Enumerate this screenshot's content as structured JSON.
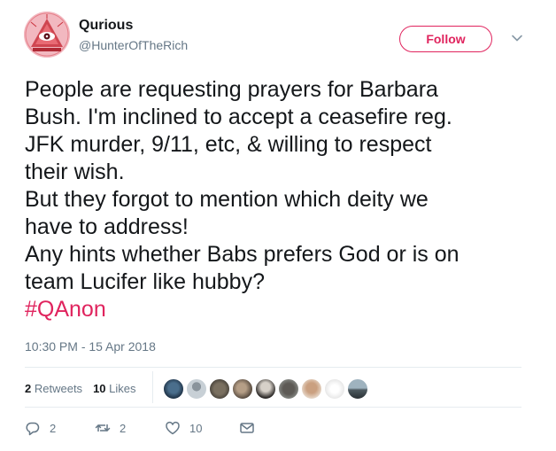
{
  "user": {
    "display_name": "Qurious",
    "handle": "@HunterOfTheRich",
    "avatar_icon": "all-seeing-eye-pyramid"
  },
  "follow_button": {
    "label": "Follow"
  },
  "tweet": {
    "lines": [
      "People are requesting prayers for Barbara",
      "Bush. I'm inclined to accept a ceasefire reg.",
      "JFK murder, 9/11, etc, & willing to respect",
      "their wish.",
      "But they forgot to mention which deity we",
      "have to address!",
      "Any hints whether Babs prefers God or is on",
      "team Lucifer like hubby?"
    ],
    "hashtag": "#QAnon",
    "timestamp": "10:30 PM - 15 Apr 2018"
  },
  "stats": {
    "retweets_count": "2",
    "retweets_label": "Retweets",
    "likes_count": "10",
    "likes_label": "Likes"
  },
  "actions": {
    "reply_count": "2",
    "retweet_count": "2",
    "like_count": "10"
  },
  "colors": {
    "accent": "#e0245e",
    "muted": "#657786",
    "divider": "#e6ecf0"
  }
}
